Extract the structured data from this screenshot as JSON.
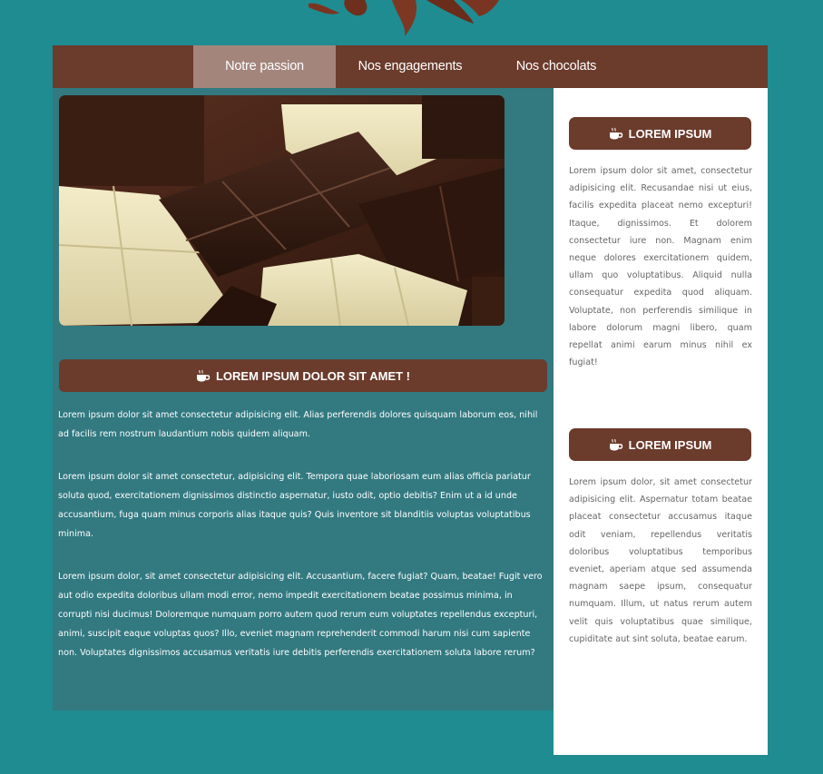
{
  "nav": {
    "items": [
      {
        "label": "Notre passion",
        "active": true
      },
      {
        "label": "Nos engagements",
        "active": false
      },
      {
        "label": "Nos chocolats",
        "active": false
      }
    ]
  },
  "main": {
    "heading": "LOREM IPSUM DOLOR SIT AMET !",
    "paragraphs": [
      "Lorem ipsum dolor sit amet consectetur adipisicing elit. Alias perferendis dolores quisquam laborum eos, nihil ad facilis rem nostrum laudantium nobis quidem aliquam.",
      "Lorem ipsum dolor sit amet consectetur, adipisicing elit. Tempora quae laboriosam eum alias officia pariatur soluta quod, exercitationem dignissimos distinctio aspernatur, iusto odit, optio debitis? Enim ut a id unde accusantium, fuga quam minus corporis alias itaque quis? Quis inventore sit blanditiis voluptas voluptatibus minima.",
      "Lorem ipsum dolor, sit amet consectetur adipisicing elit. Accusantium, facere fugiat? Quam, beatae! Fugit vero aut odio expedita doloribus ullam modi error, nemo impedit exercitationem beatae possimus minima, in corrupti nisi ducimus! Doloremque numquam porro autem quod rerum eum voluptates repellendus excepturi, animi, suscipit eaque voluptas quos? Illo, eveniet magnam reprehenderit commodi harum nisi cum sapiente non. Voluptates dignissimos accusamus veritatis iure debitis perferendis exercitationem soluta labore rerum?"
    ]
  },
  "sidebar": {
    "blocks": [
      {
        "heading": "LOREM IPSUM",
        "text": "Lorem ipsum dolor sit amet, consectetur adipisicing elit. Recusandae nisi ut eius, facilis expedita placeat nemo excepturi! Itaque, dignissimos. Et dolorem consectetur iure non. Magnam enim neque dolores exercitationem quidem, ullam quo voluptatibus. Aliquid nulla consequatur expedita quod aliquam. Voluptate, non perferendis similique in labore dolorum magni libero, quam repellat animi earum minus nihil ex fugiat!"
      },
      {
        "heading": "LOREM IPSUM",
        "text": "Lorem ipsum dolor, sit amet consectetur adipisicing elit. Aspernatur totam beatae placeat consectetur accusamus itaque odit veniam, repellendus veritatis doloribus voluptatibus temporibus eveniet, aperiam atque sed assumenda magnam saepe ipsum, consequatur numquam. Illum, ut natus rerum autem velit quis voluptatibus quae similique, cupiditate aut sint soluta, beatae earum."
      }
    ]
  },
  "icons": {
    "heading_icon": "coffee-cup-icon",
    "logo": "chocolate-splash-logo"
  },
  "colors": {
    "page_bg": "#1e8c91",
    "brown": "#6b3b2c",
    "nav_active": "#a3857c",
    "main_panel": "#327980",
    "sidebar_bg": "#ffffff",
    "sidebar_text": "#666666"
  }
}
